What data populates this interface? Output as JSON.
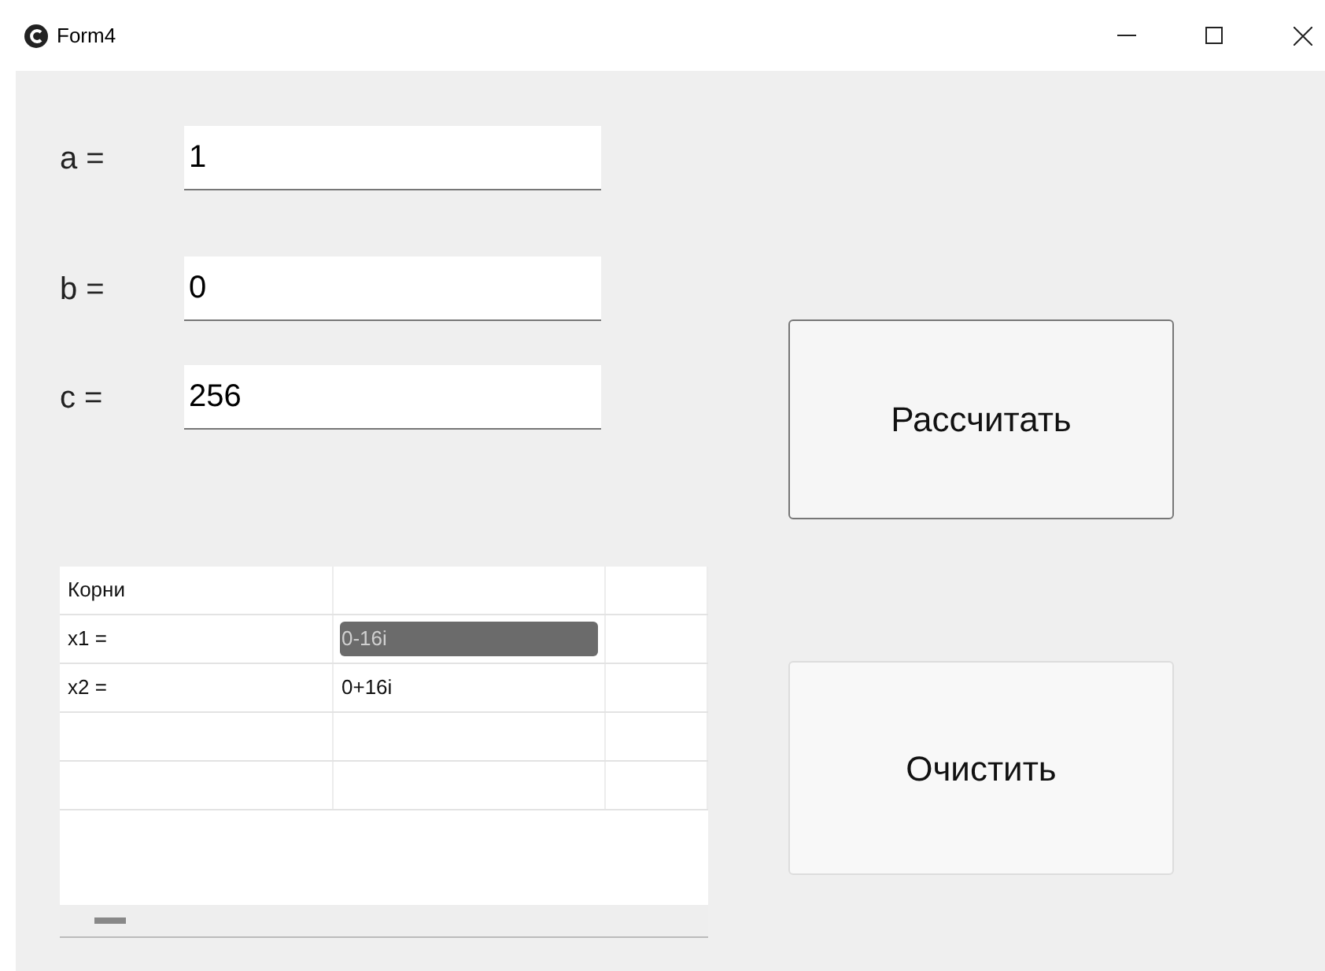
{
  "window": {
    "title": "Form4"
  },
  "fields": [
    {
      "label": "a =",
      "value": "1"
    },
    {
      "label": "b =",
      "value": "0"
    },
    {
      "label": "c =",
      "value": "256"
    }
  ],
  "buttons": [
    "Рассчитать",
    "Очистить"
  ],
  "table": {
    "rows": [
      {
        "cells": [
          {
            "text": "Корни",
            "selected": false
          },
          {
            "text": "",
            "selected": false
          },
          {
            "text": "",
            "selected": false
          }
        ]
      },
      {
        "cells": [
          {
            "text": "x1 =",
            "selected": false
          },
          {
            "text": "0-16i",
            "selected": true
          },
          {
            "text": "",
            "selected": false
          }
        ]
      },
      {
        "cells": [
          {
            "text": "x2 =",
            "selected": false
          },
          {
            "text": "0+16i",
            "selected": false
          },
          {
            "text": "",
            "selected": false
          }
        ]
      },
      {
        "cells": [
          {
            "text": "",
            "selected": false
          },
          {
            "text": "",
            "selected": false
          },
          {
            "text": "",
            "selected": false
          }
        ]
      },
      {
        "cells": [
          {
            "text": "",
            "selected": false
          },
          {
            "text": "",
            "selected": false
          },
          {
            "text": "",
            "selected": false
          }
        ]
      }
    ]
  }
}
